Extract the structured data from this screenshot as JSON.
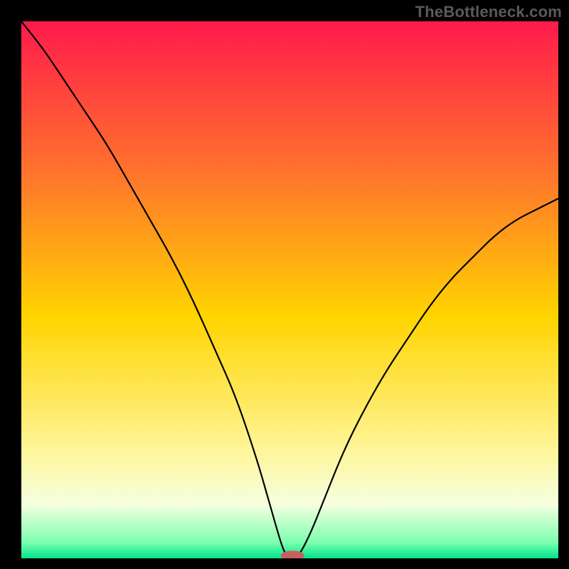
{
  "watermark": "TheBottleneck.com",
  "chart_data": {
    "type": "line",
    "title": "",
    "xlabel": "",
    "ylabel": "",
    "xlim": [
      0,
      100
    ],
    "ylim": [
      0,
      100
    ],
    "grid": false,
    "legend": false,
    "background_gradient": {
      "stops": [
        {
          "pos": 0.0,
          "color": "#ff1a4b"
        },
        {
          "pos": 0.3,
          "color": "#ff7a2a"
        },
        {
          "pos": 0.55,
          "color": "#ffd400"
        },
        {
          "pos": 0.8,
          "color": "#fff59a"
        },
        {
          "pos": 0.9,
          "color": "#f5ffe0"
        },
        {
          "pos": 0.97,
          "color": "#7dffb0"
        },
        {
          "pos": 1.0,
          "color": "#00e58a"
        }
      ]
    },
    "series": [
      {
        "name": "bottleneck-curve",
        "color": "#000000",
        "x": [
          0,
          4,
          8,
          12,
          16,
          20,
          24,
          28,
          32,
          36,
          40,
          44,
          46,
          48,
          49,
          50,
          51,
          52,
          54,
          56,
          60,
          64,
          68,
          72,
          76,
          80,
          84,
          88,
          92,
          96,
          100
        ],
        "y": [
          100,
          95,
          89,
          83,
          77,
          70,
          63,
          56,
          48,
          39,
          30,
          18,
          11,
          4,
          1,
          0,
          0,
          1,
          5,
          10,
          20,
          28,
          35,
          41,
          47,
          52,
          56,
          60,
          63,
          65,
          67
        ]
      }
    ],
    "marker": {
      "name": "optimal-point",
      "x": 50.5,
      "y": 0,
      "color": "#c66060",
      "rx": 2.2,
      "ry": 0.9
    }
  }
}
